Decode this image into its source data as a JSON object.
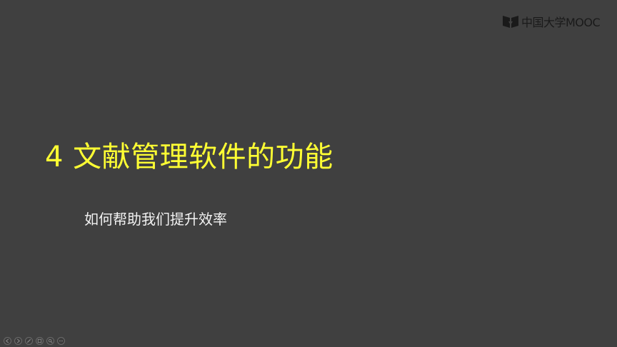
{
  "slide": {
    "title": "4 文献管理软件的功能",
    "subtitle": "如何帮助我们提升效率"
  },
  "logo": {
    "text": "中国大学MOOC",
    "icon": "mooc-logo-icon"
  },
  "controls": [
    {
      "name": "previous-slide-button",
      "icon": "arrow-left-icon"
    },
    {
      "name": "next-slide-button",
      "icon": "arrow-right-icon"
    },
    {
      "name": "pen-tool-button",
      "icon": "pen-icon"
    },
    {
      "name": "slide-sorter-button",
      "icon": "slides-grid-icon"
    },
    {
      "name": "zoom-button",
      "icon": "magnifier-icon"
    },
    {
      "name": "more-options-button",
      "icon": "ellipsis-icon"
    }
  ],
  "colors": {
    "background": "#404040",
    "title": "#ffff33",
    "subtitle": "#f2f2f2",
    "logo": "#1a1a1a"
  }
}
